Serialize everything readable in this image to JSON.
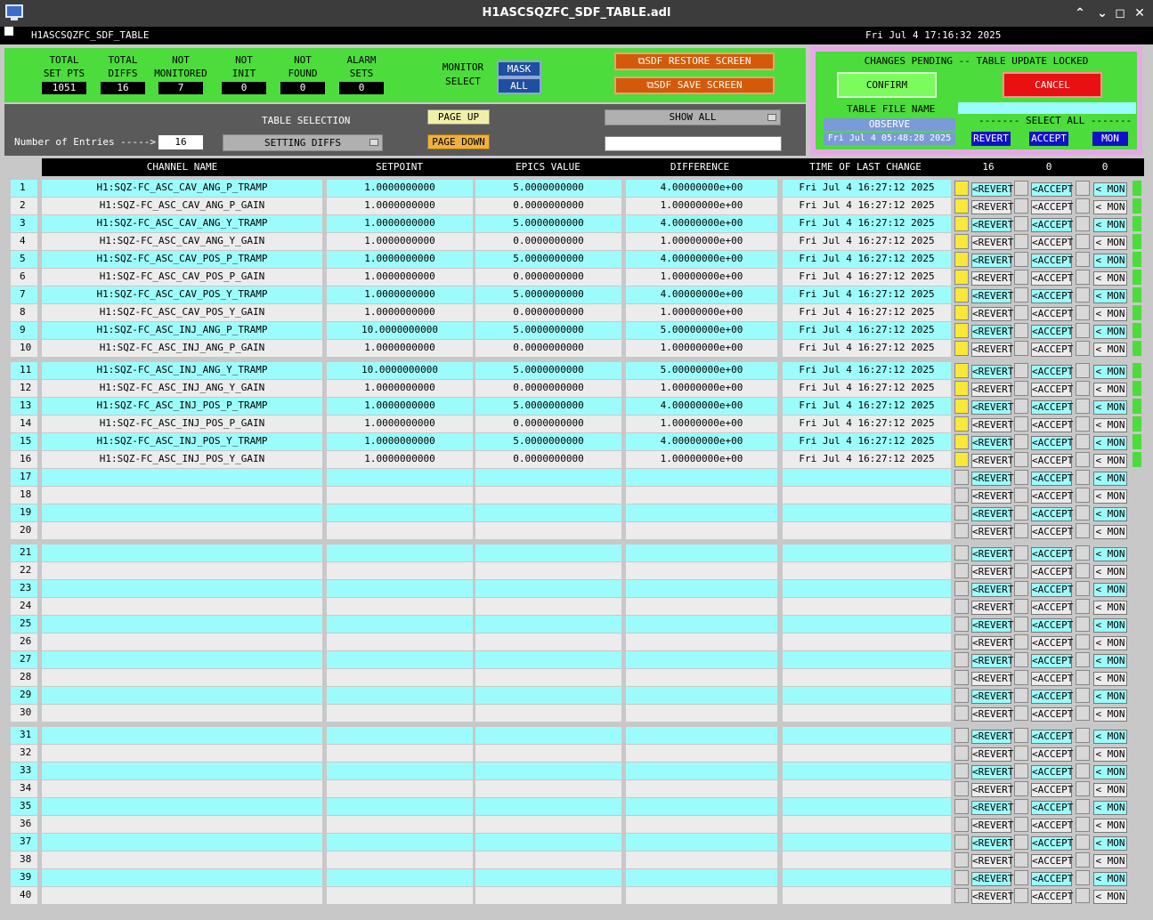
{
  "window": {
    "title": "H1ASCSQZFC_SDF_TABLE.adl",
    "min": "⌃",
    "max": "⌄",
    "restore": "◻",
    "close": "✕"
  },
  "topbar": {
    "name": "H1ASCSQZFC_SDF_TABLE",
    "datetime": "Fri Jul  4 17:16:32 2025"
  },
  "stats": [
    {
      "l1": "TOTAL",
      "l2": "SET PTS",
      "v": "1051"
    },
    {
      "l1": "TOTAL",
      "l2": "DIFFS",
      "v": "16"
    },
    {
      "l1": "NOT",
      "l2": "MONITORED",
      "v": "7"
    },
    {
      "l1": "NOT",
      "l2": "INIT",
      "v": "0"
    },
    {
      "l1": "NOT",
      "l2": "FOUND",
      "v": "0"
    },
    {
      "l1": "ALARM",
      "l2": "SETS",
      "v": "0"
    }
  ],
  "monitor": {
    "l1": "MONITOR",
    "l2": "SELECT",
    "mask": "MASK",
    "all": "ALL"
  },
  "actions": {
    "restore": "⧉SDF RESTORE SCREEN",
    "save": "⧉SDF SAVE SCREEN"
  },
  "selection": {
    "table_label": "TABLE SELECTION",
    "entries_label": "Number of Entries ----->",
    "entries": "16",
    "setting": "SETTING DIFFS",
    "page_up": "PAGE UP",
    "page_down": "PAGE DOWN",
    "show_all": "SHOW ALL"
  },
  "pending": {
    "title": "CHANGES PENDING -- TABLE UPDATE LOCKED",
    "confirm": "CONFIRM",
    "cancel": "CANCEL",
    "file_label": "TABLE FILE NAME",
    "file": "OBSERVE",
    "file_time": "Fri Jul  4 05:48:28 2025",
    "select_all": "------- SELECT ALL -------",
    "revert": "REVERT",
    "accept": "ACCEPT",
    "mon": "MON"
  },
  "headers": {
    "channel": "CHANNEL NAME",
    "setpoint": "SETPOINT",
    "epics": "EPICS VALUE",
    "diff": "DIFFERENCE",
    "time": "TIME OF LAST CHANGE",
    "c1": "16",
    "c2": "0",
    "c3": "0"
  },
  "rowbtn": {
    "revert": "<REVERT",
    "accept": "<ACCEPT",
    "mon": "< MON"
  },
  "rows": [
    {
      "n": "1",
      "ch": "H1:SQZ-FC_ASC_CAV_ANG_P_TRAMP",
      "sp": "1.0000000000",
      "ev": "5.0000000000",
      "df": "4.00000000e+00",
      "tm": "Fri Jul  4 16:27:12 2025"
    },
    {
      "n": "2",
      "ch": "H1:SQZ-FC_ASC_CAV_ANG_P_GAIN",
      "sp": "1.0000000000",
      "ev": "0.0000000000",
      "df": "1.00000000e+00",
      "tm": "Fri Jul  4 16:27:12 2025"
    },
    {
      "n": "3",
      "ch": "H1:SQZ-FC_ASC_CAV_ANG_Y_TRAMP",
      "sp": "1.0000000000",
      "ev": "5.0000000000",
      "df": "4.00000000e+00",
      "tm": "Fri Jul  4 16:27:12 2025"
    },
    {
      "n": "4",
      "ch": "H1:SQZ-FC_ASC_CAV_ANG_Y_GAIN",
      "sp": "1.0000000000",
      "ev": "0.0000000000",
      "df": "1.00000000e+00",
      "tm": "Fri Jul  4 16:27:12 2025"
    },
    {
      "n": "5",
      "ch": "H1:SQZ-FC_ASC_CAV_POS_P_TRAMP",
      "sp": "1.0000000000",
      "ev": "5.0000000000",
      "df": "4.00000000e+00",
      "tm": "Fri Jul  4 16:27:12 2025"
    },
    {
      "n": "6",
      "ch": "H1:SQZ-FC_ASC_CAV_POS_P_GAIN",
      "sp": "1.0000000000",
      "ev": "0.0000000000",
      "df": "1.00000000e+00",
      "tm": "Fri Jul  4 16:27:12 2025"
    },
    {
      "n": "7",
      "ch": "H1:SQZ-FC_ASC_CAV_POS_Y_TRAMP",
      "sp": "1.0000000000",
      "ev": "5.0000000000",
      "df": "4.00000000e+00",
      "tm": "Fri Jul  4 16:27:12 2025"
    },
    {
      "n": "8",
      "ch": "H1:SQZ-FC_ASC_CAV_POS_Y_GAIN",
      "sp": "1.0000000000",
      "ev": "0.0000000000",
      "df": "1.00000000e+00",
      "tm": "Fri Jul  4 16:27:12 2025"
    },
    {
      "n": "9",
      "ch": "H1:SQZ-FC_ASC_INJ_ANG_P_TRAMP",
      "sp": "10.0000000000",
      "ev": "5.0000000000",
      "df": "5.00000000e+00",
      "tm": "Fri Jul  4 16:27:12 2025"
    },
    {
      "n": "10",
      "ch": "H1:SQZ-FC_ASC_INJ_ANG_P_GAIN",
      "sp": "1.0000000000",
      "ev": "0.0000000000",
      "df": "1.00000000e+00",
      "tm": "Fri Jul  4 16:27:12 2025"
    },
    {
      "n": "11",
      "ch": "H1:SQZ-FC_ASC_INJ_ANG_Y_TRAMP",
      "sp": "10.0000000000",
      "ev": "5.0000000000",
      "df": "5.00000000e+00",
      "tm": "Fri Jul  4 16:27:12 2025"
    },
    {
      "n": "12",
      "ch": "H1:SQZ-FC_ASC_INJ_ANG_Y_GAIN",
      "sp": "1.0000000000",
      "ev": "0.0000000000",
      "df": "1.00000000e+00",
      "tm": "Fri Jul  4 16:27:12 2025"
    },
    {
      "n": "13",
      "ch": "H1:SQZ-FC_ASC_INJ_POS_P_TRAMP",
      "sp": "1.0000000000",
      "ev": "5.0000000000",
      "df": "4.00000000e+00",
      "tm": "Fri Jul  4 16:27:12 2025"
    },
    {
      "n": "14",
      "ch": "H1:SQZ-FC_ASC_INJ_POS_P_GAIN",
      "sp": "1.0000000000",
      "ev": "0.0000000000",
      "df": "1.00000000e+00",
      "tm": "Fri Jul  4 16:27:12 2025"
    },
    {
      "n": "15",
      "ch": "H1:SQZ-FC_ASC_INJ_POS_Y_TRAMP",
      "sp": "1.0000000000",
      "ev": "5.0000000000",
      "df": "4.00000000e+00",
      "tm": "Fri Jul  4 16:27:12 2025"
    },
    {
      "n": "16",
      "ch": "H1:SQZ-FC_ASC_INJ_POS_Y_GAIN",
      "sp": "1.0000000000",
      "ev": "0.0000000000",
      "df": "1.00000000e+00",
      "tm": "Fri Jul  4 16:27:12 2025"
    },
    {
      "n": "17",
      "ch": "",
      "sp": "",
      "ev": "",
      "df": "",
      "tm": ""
    },
    {
      "n": "18",
      "ch": "",
      "sp": "",
      "ev": "",
      "df": "",
      "tm": ""
    },
    {
      "n": "19",
      "ch": "",
      "sp": "",
      "ev": "",
      "df": "",
      "tm": ""
    },
    {
      "n": "20",
      "ch": "",
      "sp": "",
      "ev": "",
      "df": "",
      "tm": ""
    },
    {
      "n": "21",
      "ch": "",
      "sp": "",
      "ev": "",
      "df": "",
      "tm": ""
    },
    {
      "n": "22",
      "ch": "",
      "sp": "",
      "ev": "",
      "df": "",
      "tm": ""
    },
    {
      "n": "23",
      "ch": "",
      "sp": "",
      "ev": "",
      "df": "",
      "tm": ""
    },
    {
      "n": "24",
      "ch": "",
      "sp": "",
      "ev": "",
      "df": "",
      "tm": ""
    },
    {
      "n": "25",
      "ch": "",
      "sp": "",
      "ev": "",
      "df": "",
      "tm": ""
    },
    {
      "n": "26",
      "ch": "",
      "sp": "",
      "ev": "",
      "df": "",
      "tm": ""
    },
    {
      "n": "27",
      "ch": "",
      "sp": "",
      "ev": "",
      "df": "",
      "tm": ""
    },
    {
      "n": "28",
      "ch": "",
      "sp": "",
      "ev": "",
      "df": "",
      "tm": ""
    },
    {
      "n": "29",
      "ch": "",
      "sp": "",
      "ev": "",
      "df": "",
      "tm": ""
    },
    {
      "n": "30",
      "ch": "",
      "sp": "",
      "ev": "",
      "df": "",
      "tm": ""
    },
    {
      "n": "31",
      "ch": "",
      "sp": "",
      "ev": "",
      "df": "",
      "tm": ""
    },
    {
      "n": "32",
      "ch": "",
      "sp": "",
      "ev": "",
      "df": "",
      "tm": ""
    },
    {
      "n": "33",
      "ch": "",
      "sp": "",
      "ev": "",
      "df": "",
      "tm": ""
    },
    {
      "n": "34",
      "ch": "",
      "sp": "",
      "ev": "",
      "df": "",
      "tm": ""
    },
    {
      "n": "35",
      "ch": "",
      "sp": "",
      "ev": "",
      "df": "",
      "tm": ""
    },
    {
      "n": "36",
      "ch": "",
      "sp": "",
      "ev": "",
      "df": "",
      "tm": ""
    },
    {
      "n": "37",
      "ch": "",
      "sp": "",
      "ev": "",
      "df": "",
      "tm": ""
    },
    {
      "n": "38",
      "ch": "",
      "sp": "",
      "ev": "",
      "df": "",
      "tm": ""
    },
    {
      "n": "39",
      "ch": "",
      "sp": "",
      "ev": "",
      "df": "",
      "tm": ""
    },
    {
      "n": "40",
      "ch": "",
      "sp": "",
      "ev": "",
      "df": "",
      "tm": ""
    }
  ],
  "colors": {
    "cyan": "#9cfcfc",
    "grey": "#ececec",
    "yellow": "#f8e838",
    "green": "#4cdc3c"
  }
}
